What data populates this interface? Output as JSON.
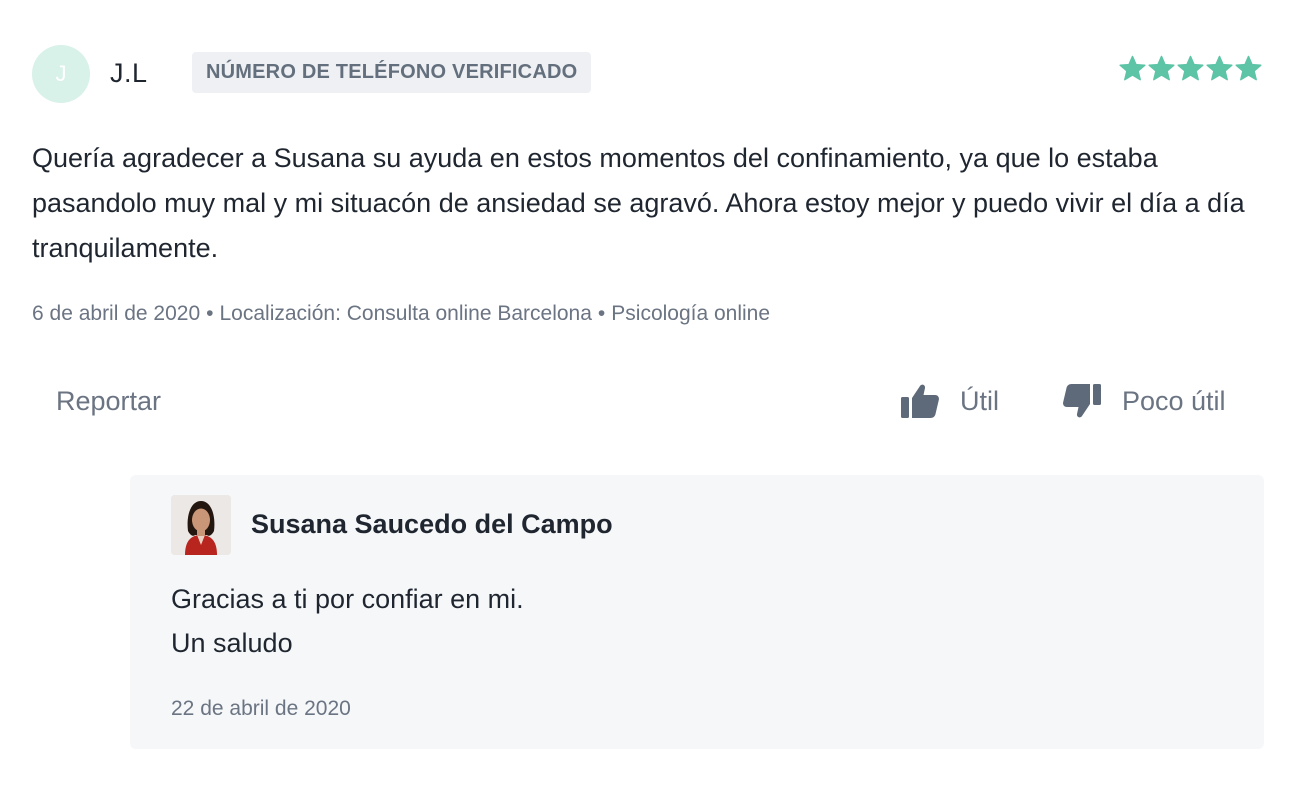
{
  "review": {
    "avatar_initial": "J",
    "author": "J.L",
    "badge": "NÚMERO DE TELÉFONO VERIFICADO",
    "rating": 5,
    "rating_max": 5,
    "star_color": "#5dc4a6",
    "text": "Quería agradecer a Susana su ayuda en estos momentos del confinamiento, ya que lo estaba pasandolo muy mal y mi situacón de ansiedad se agravó. Ahora estoy mejor y puedo vivir el día a día tranquilamente.",
    "meta": {
      "date": "6 de abril de 2020",
      "location": "Localización: Consulta online Barcelona",
      "service": "Psicología online",
      "separator": "•"
    },
    "actions": {
      "report_label": "Reportar",
      "useful_label": "Útil",
      "useful_icon": "thumbs-up-icon",
      "not_useful_label": "Poco útil",
      "not_useful_icon": "thumbs-down-icon"
    }
  },
  "reply": {
    "author": "Susana Saucedo del Campo",
    "photo_icon": "profile-photo",
    "text_lines": [
      "Gracias a ti por confiar en mi.",
      "Un saludo"
    ],
    "date": "22 de abril de 2020"
  }
}
